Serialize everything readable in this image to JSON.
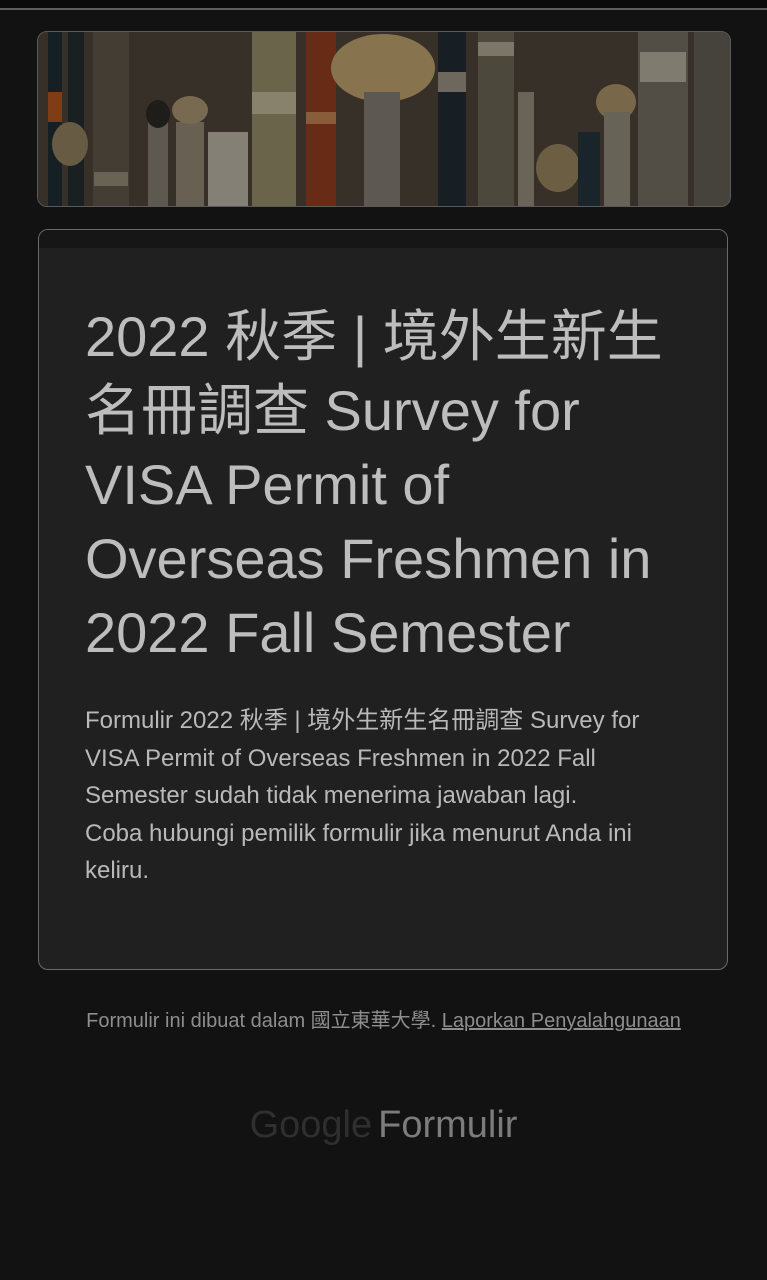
{
  "colors": {
    "background": "#121212",
    "card": "#202020",
    "text": "#bdbdbd",
    "muted": "#8e8e8e"
  },
  "header_image": {
    "description_icon": "paint-brushes-image"
  },
  "form": {
    "title": "2022 秋季 | 境外生新生名冊調查  Survey for VISA Permit of Overseas Freshmen in 2022 Fall Semester",
    "closed_message": "Formulir 2022 秋季 | 境外生新生名冊調查  Survey for VISA Permit of Overseas Freshmen in 2022 Fall Semester sudah tidak menerima jawaban lagi.",
    "contact_message": "Coba hubungi pemilik formulir jika menurut Anda ini keliru."
  },
  "footer": {
    "created_in": "Formulir ini dibuat dalam 國立東華大學.",
    "report_link": "Laporkan Penyalahgunaan"
  },
  "brand": {
    "google": "Google",
    "product": "Formulir"
  }
}
